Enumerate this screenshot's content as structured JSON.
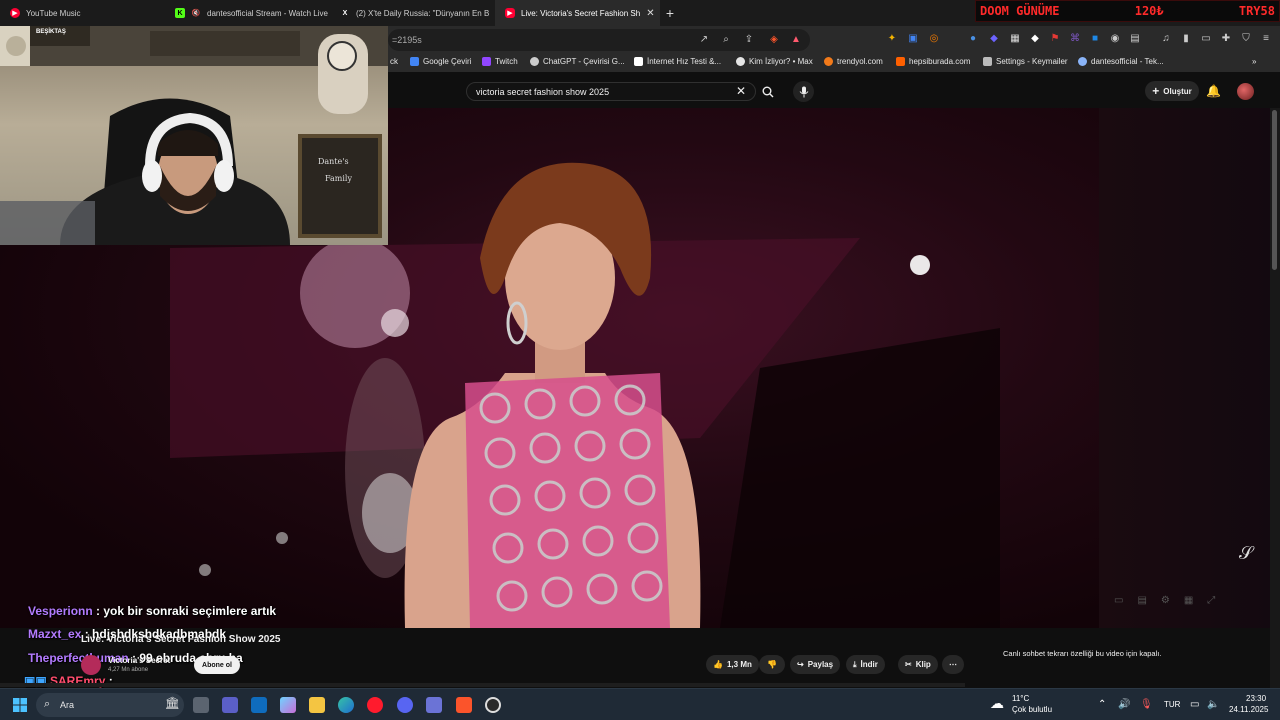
{
  "tabs": [
    {
      "label": "YouTube Music",
      "icon": "youtube-music-icon",
      "color": "#ff0033",
      "active": false
    },
    {
      "label": "dantesofficial Stream - Watch Live",
      "icon": "kick-icon",
      "color": "#53fc18",
      "active": false
    },
    {
      "label": "(2) X'te Daily Russia: \"Dünyanın En B",
      "icon": "x-icon",
      "color": "#ffffff",
      "active": false
    },
    {
      "label": "Live: Victoria's Secret Fashion Sh",
      "icon": "youtube-icon",
      "color": "#ff0033",
      "active": true
    }
  ],
  "banner": {
    "left": "DOOM GÜNÜME",
    "mid": "120₺",
    "right": "TRY58"
  },
  "address": {
    "url": "=2195s"
  },
  "bookmarks": [
    {
      "label": "Google Çeviri",
      "color": "#4285f4"
    },
    {
      "label": "Twitch",
      "color": "#9146ff"
    },
    {
      "label": "ChatGPT - Çevirisi G...",
      "color": "#cccccc"
    },
    {
      "label": "İnternet Hız Testi &...",
      "color": "#ffffff"
    },
    {
      "label": "Kim İzliyor? • Max",
      "color": "#e5e5e5"
    },
    {
      "label": "trendyol.com",
      "color": "#f27a1a"
    },
    {
      "label": "hepsiburada.com",
      "color": "#ff6000"
    },
    {
      "label": "Settings - Keymailer",
      "color": "#bbbbbb"
    },
    {
      "label": "dantesofficial - Tek...",
      "color": "#8ab4f8"
    }
  ],
  "bookmarks_prefix": "ck",
  "youtube": {
    "search_query": "victoria secret fashion show 2025",
    "create_label": "Oluştur"
  },
  "webcam": {
    "badge": "BEŞİKTAŞ",
    "sign_text": "Dante's Family"
  },
  "chat": [
    {
      "user": "Vesperionn",
      "message": " : yok bir sonraki seçimlere artık"
    },
    {
      "user": "Mazxt_ex",
      "message": " : hdjshdkshdkadbmabdk"
    },
    {
      "user": "Theperfecthuman",
      "message": " : 99 ebruda ebru ha"
    },
    {
      "user": "SAREmry",
      "message": " : "
    }
  ],
  "video": {
    "title": "Live: Victoria's Secret Fashion Show 2025",
    "channel": "Victoria's Secret",
    "subscribers": "4,27 Mn abone",
    "subscribe_label": "Abone ol"
  },
  "actions": {
    "likes": "1,3 Mn",
    "share": "Paylaş",
    "download": "İndir",
    "clip": "Klip"
  },
  "live_chat_notice": "Canlı sohbet tekrarı özelliği bu video için kapalı.",
  "taskbar": {
    "search_placeholder": "Ara",
    "weather_temp": "11°C",
    "weather_desc": "Çok bulutlu",
    "language": "TUR",
    "time": "23:30",
    "date": "24.11.2025"
  }
}
